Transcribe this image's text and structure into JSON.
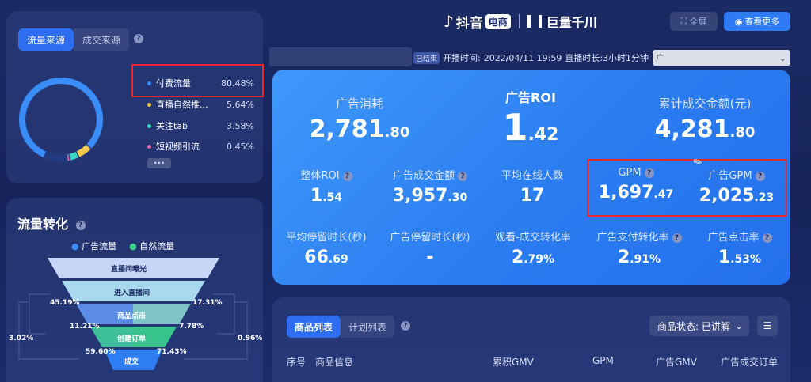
{
  "brand": {
    "douyin_text": "抖音",
    "douyin_badge": "电商",
    "qianchuan_text": "巨量千川"
  },
  "top_buttons": {
    "fullscreen": "全屏",
    "view_more": "查看更多"
  },
  "live_info": {
    "status_badge": "已结束",
    "start_time_label": "开播时间:",
    "start_time": "2022/04/11 19:59",
    "duration_label": "直播时长:",
    "duration": "3小时1分钟",
    "dropdown_value": "广"
  },
  "traffic_source": {
    "tabs": [
      "流量来源",
      "成交来源"
    ],
    "active_tab": 0,
    "items": [
      {
        "label": "付费流量",
        "pct": "80.48%",
        "color": "#3a8cf7",
        "share": 80.48
      },
      {
        "label": "直播自然推...",
        "pct": "5.64%",
        "color": "#f2c94c",
        "share": 5.64
      },
      {
        "label": "关注tab",
        "pct": "3.58%",
        "color": "#3cd7c4",
        "share": 3.58
      },
      {
        "label": "短视频引流",
        "pct": "0.45%",
        "color": "#e66bb0",
        "share": 0.45
      }
    ],
    "more": "•••"
  },
  "funnel": {
    "title": "流量转化",
    "legend": [
      {
        "label": "广告流量",
        "color": "#3a8cf7"
      },
      {
        "label": "自然流量",
        "color": "#3cd28c"
      }
    ],
    "stages": [
      "直播间曝光",
      "进入直播间",
      "商品点击",
      "创建订单",
      "成交"
    ],
    "left_pcts": [
      "45.19%",
      "11.21%",
      "59.60%"
    ],
    "right_pcts": [
      "17.31%",
      "7.78%",
      "71.43%"
    ],
    "outer_left": "3.02%",
    "outer_right": "0.96%"
  },
  "metrics": {
    "top": [
      {
        "label": "广告消耗",
        "int": "2,781",
        "dec": ".80"
      },
      {
        "label": "广告ROI",
        "int": "1",
        "dec": ".42"
      },
      {
        "label": "累计成交金额(元)",
        "int": "4,281",
        "dec": ".80"
      }
    ],
    "row2": [
      {
        "label": "整体ROI",
        "int": "1",
        "dec": ".54"
      },
      {
        "label": "广告成交金额",
        "int": "3,957",
        "dec": ".30"
      },
      {
        "label": "平均在线人数",
        "int": "17",
        "dec": ""
      },
      {
        "label": "GPM",
        "int": "1,697",
        "dec": ".47"
      },
      {
        "label": "广告GPM",
        "int": "2,025",
        "dec": ".23"
      }
    ],
    "row3": [
      {
        "label": "平均停留时长(秒)",
        "int": "66",
        "dec": ".69"
      },
      {
        "label": "广告停留时长(秒)",
        "int": "-",
        "dec": ""
      },
      {
        "label": "观看-成交转化率",
        "int": "2",
        "dec": ".79%"
      },
      {
        "label": "广告支付转化率",
        "int": "2",
        "dec": ".91%"
      },
      {
        "label": "广告点击率",
        "int": "1",
        "dec": ".53%"
      }
    ]
  },
  "product_panel": {
    "tabs": [
      "商品列表",
      "计划列表"
    ],
    "status_filter": "商品状态: 已讲解",
    "columns": [
      "序号",
      "商品信息",
      "累积GMV",
      "GPM",
      "广告GMV",
      "广告成交订单"
    ]
  }
}
